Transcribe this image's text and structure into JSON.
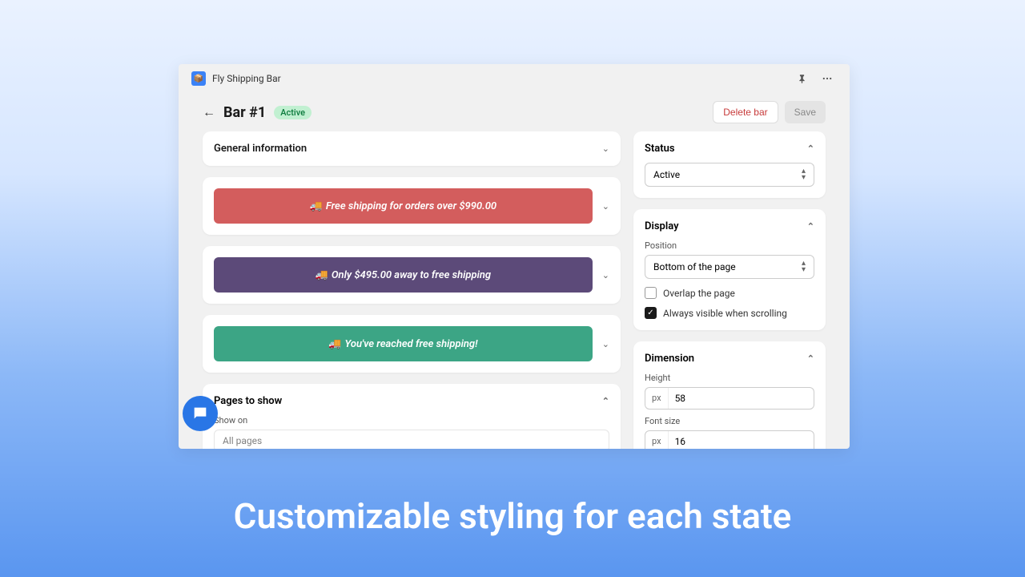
{
  "app": {
    "title": "Fly Shipping Bar",
    "icon_glyph": "📦"
  },
  "page": {
    "title": "Bar #1",
    "badge": "Active",
    "delete_label": "Delete bar",
    "save_label": "Save"
  },
  "left": {
    "general_info": "General information",
    "bars": [
      {
        "emoji": "🚚",
        "text": "Free shipping for orders over $990.00",
        "color": "bar-red"
      },
      {
        "emoji": "🚚",
        "text": "Only $495.00 away to free shipping",
        "color": "bar-purple"
      },
      {
        "emoji": "🚚",
        "text": "You've reached free shipping!",
        "color": "bar-teal"
      }
    ],
    "pages_to_show": "Pages to show",
    "show_on_label": "Show on",
    "show_on_value": "All pages"
  },
  "right": {
    "status": {
      "title": "Status",
      "value": "Active"
    },
    "display": {
      "title": "Display",
      "position_label": "Position",
      "position_value": "Bottom of the page",
      "overlap_label": "Overlap the page",
      "overlap_checked": false,
      "always_visible_label": "Always visible when scrolling",
      "always_visible_checked": true
    },
    "dimension": {
      "title": "Dimension",
      "height_label": "Height",
      "height_unit": "px",
      "height_value": "58",
      "fontsize_label": "Font size",
      "fontsize_unit": "px",
      "fontsize_value": "16"
    }
  },
  "caption": "Customizable styling for each state"
}
